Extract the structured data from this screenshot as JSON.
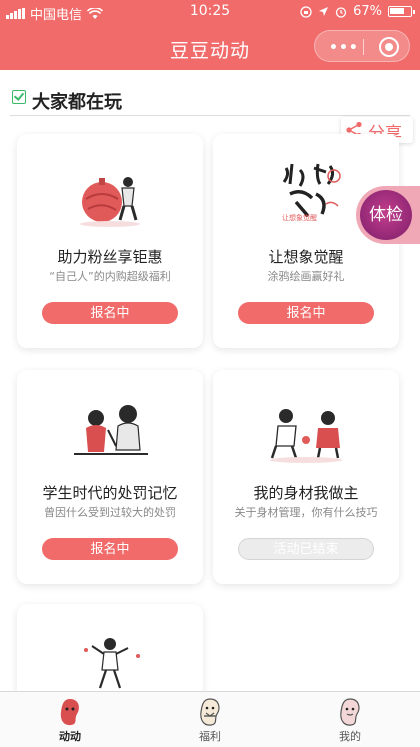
{
  "status": {
    "carrier": "中国电信",
    "time": "10:25",
    "battery": "67%"
  },
  "nav": {
    "title": "豆豆动动",
    "more_label": "•••"
  },
  "section": {
    "title": "大家都在玩"
  },
  "share": {
    "label": "分享"
  },
  "float_badge": {
    "label": "体检"
  },
  "cards": [
    {
      "title": "助力粉丝享钜惠",
      "subtitle": "“自己人”的内购超级福利",
      "button": "报名中",
      "status": "active",
      "art_text": ""
    },
    {
      "title": "让想象觉醒",
      "subtitle": "涂鸦绘画赢好礼",
      "button": "报名中",
      "status": "active",
      "art_text": "让想象觉醒"
    },
    {
      "title": "学生时代的处罚记忆",
      "subtitle": "曾因什么受到过较大的处罚",
      "button": "报名中",
      "status": "active",
      "art_text": ""
    },
    {
      "title": "我的身材我做主",
      "subtitle": "关于身材管理，你有什么技巧",
      "button": "活动已结束",
      "status": "ended",
      "art_text": ""
    }
  ],
  "tabs": [
    {
      "label": "动动",
      "active": true
    },
    {
      "label": "福利",
      "active": false
    },
    {
      "label": "我的",
      "active": false
    }
  ],
  "colors": {
    "brand": "#f16b6b",
    "check": "#3cba6a",
    "badge": "#a12a7c"
  }
}
